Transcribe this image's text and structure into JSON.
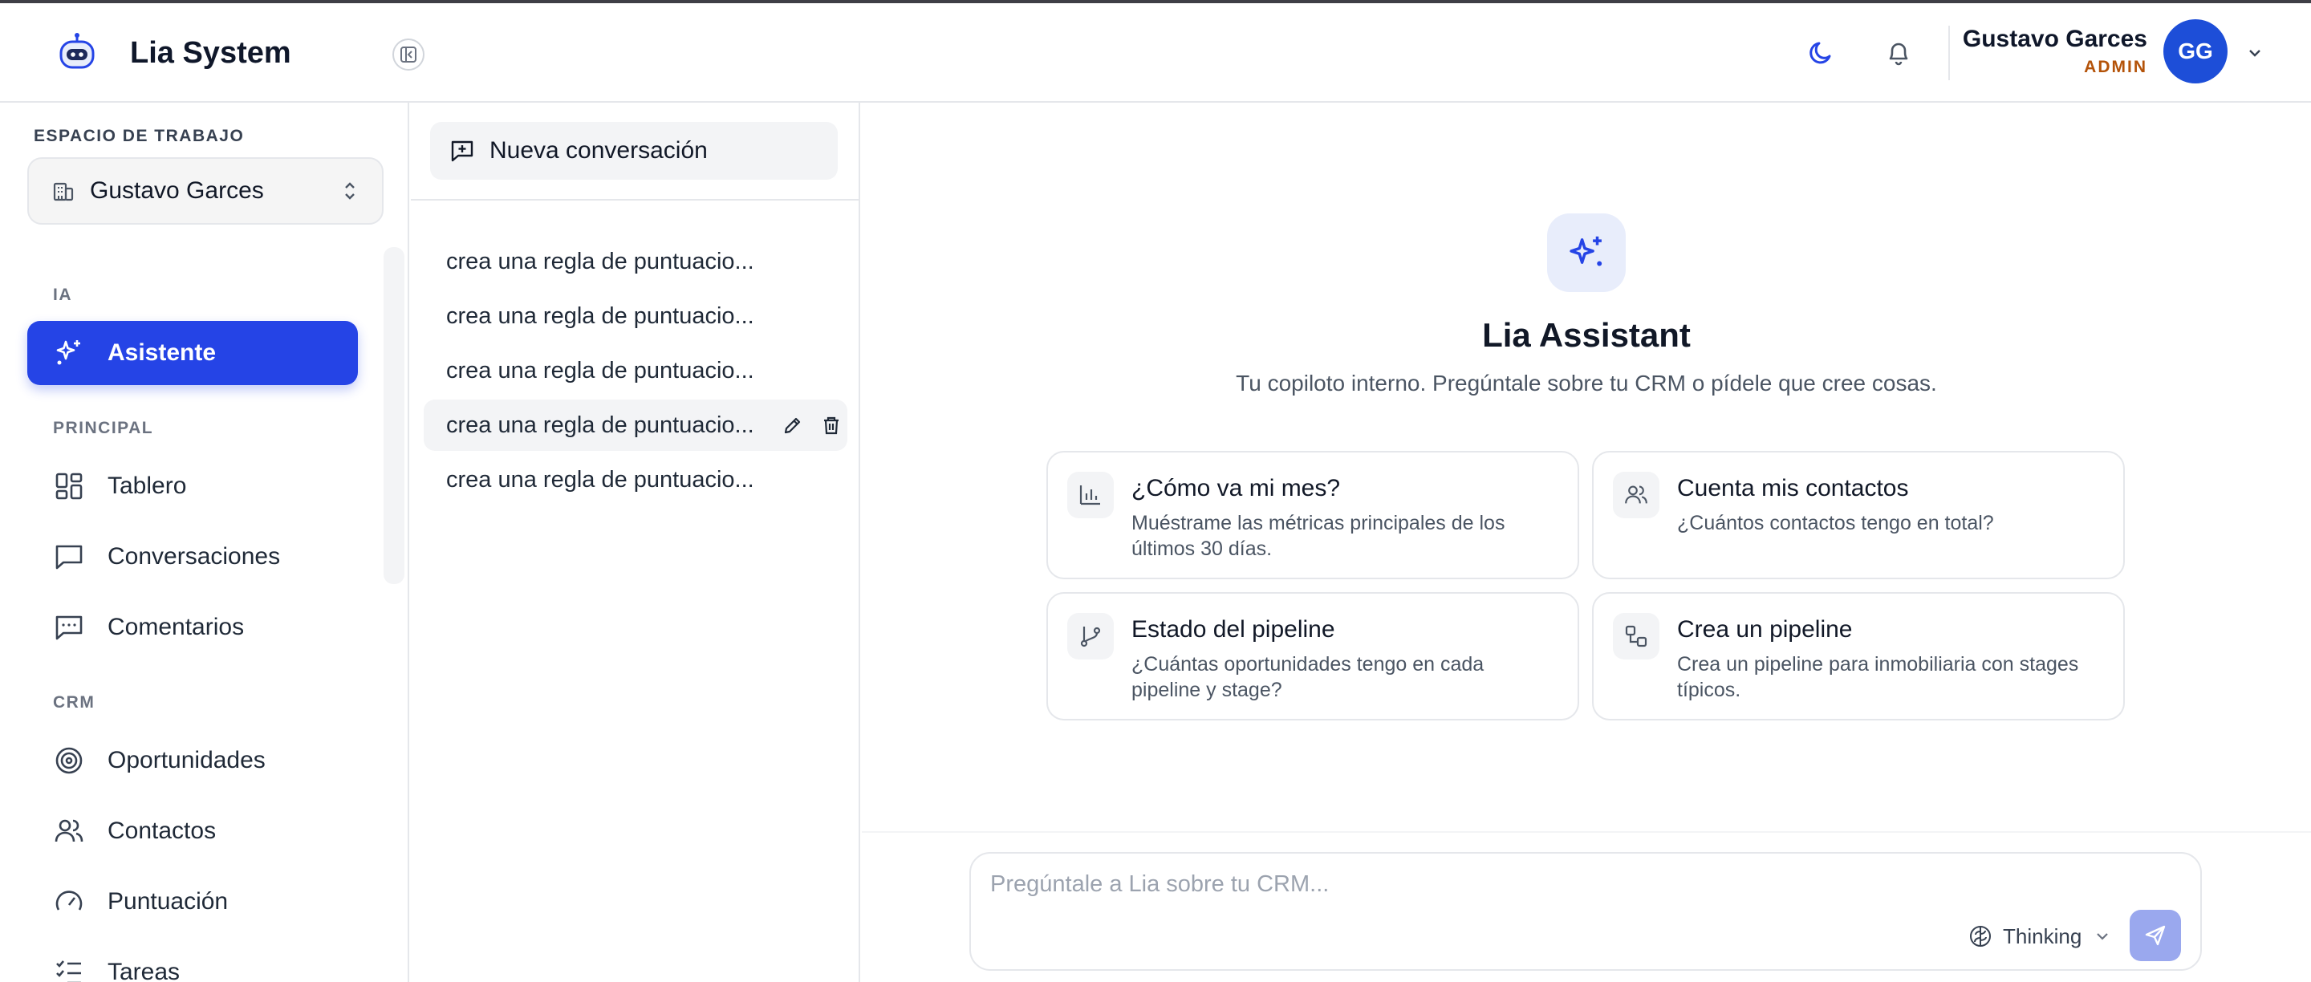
{
  "app": {
    "title": "Lia System"
  },
  "header": {
    "user_name": "Gustavo Garces",
    "user_role": "ADMIN",
    "avatar_initials": "GG",
    "icons": [
      "moon-icon",
      "bell-icon",
      "chevron-down-icon"
    ]
  },
  "sidebar": {
    "workspace_label": "ESPACIO DE TRABAJO",
    "workspace_name": "Gustavo Garces",
    "sections": [
      {
        "label": "IA"
      },
      {
        "label": "PRINCIPAL"
      },
      {
        "label": "CRM"
      }
    ],
    "items": [
      {
        "label": "Asistente",
        "icon": "sparkles-icon",
        "active": true
      },
      {
        "label": "Tablero",
        "icon": "dashboard-icon"
      },
      {
        "label": "Conversaciones",
        "icon": "message-square-icon"
      },
      {
        "label": "Comentarios",
        "icon": "message-dots-icon"
      },
      {
        "label": "Oportunidades",
        "icon": "target-icon"
      },
      {
        "label": "Contactos",
        "icon": "users-icon"
      },
      {
        "label": "Puntuación",
        "icon": "gauge-icon"
      },
      {
        "label": "Tareas",
        "icon": "list-checks-icon"
      }
    ]
  },
  "conversations": {
    "new_label": "Nueva conversación",
    "items": [
      {
        "title": "crea una regla de puntuacio..."
      },
      {
        "title": "crea una regla de puntuacio..."
      },
      {
        "title": "crea una regla de puntuacio..."
      },
      {
        "title": "crea una regla de puntuacio...",
        "hovered": true
      },
      {
        "title": "crea una regla de puntuacio..."
      }
    ]
  },
  "main": {
    "title": "Lia Assistant",
    "subtitle": "Tu copiloto interno. Pregúntale sobre tu CRM o pídele que cree cosas.",
    "cards": [
      {
        "title": "¿Cómo va mi mes?",
        "desc_line1": "Muéstrame las métricas principales de los",
        "desc_line2": "últimos 30 días.",
        "icon": "bar-chart-icon"
      },
      {
        "title": "Cuenta mis contactos",
        "desc_line1": "¿Cuántos contactos tengo en total?",
        "desc_line2": "",
        "icon": "users-icon"
      },
      {
        "title": "Estado del pipeline",
        "desc_line1": "¿Cuántas oportunidades tengo en cada",
        "desc_line2": "pipeline y stage?",
        "icon": "git-branch-icon"
      },
      {
        "title": "Crea un pipeline",
        "desc_line1": "Crea un pipeline para inmobiliaria con stages",
        "desc_line2": "típicos.",
        "icon": "workflow-icon"
      }
    ],
    "composer": {
      "placeholder": "Pregúntale a Lia sobre tu CRM...",
      "mode_label": "Thinking"
    }
  },
  "colors": {
    "accent": "#2544e6",
    "role": "#b45309",
    "avatar": "#1d4ed8",
    "send_button": "#9aa8ee"
  }
}
